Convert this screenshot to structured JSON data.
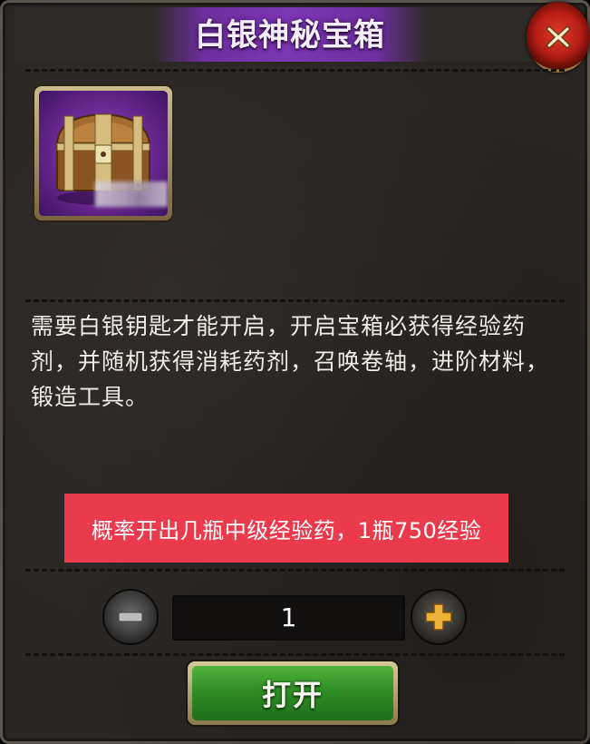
{
  "dialog": {
    "title": "白银神秘宝箱"
  },
  "item": {
    "icon": "treasure-chest-icon",
    "description": "需要白银钥匙才能开启，开启宝箱必获得经验药剂，并随机获得消耗药剂，召唤卷轴，进阶材料，锻造工具。"
  },
  "notice": {
    "text": "概率开出几瓶中级经验药，1瓶750经验"
  },
  "quantity": {
    "value": "1"
  },
  "actions": {
    "open_label": "打开"
  },
  "colors": {
    "title_banner": "#7d36b3",
    "notice_bg": "#ec3a4d",
    "open_button": "#2f8e25",
    "close_button": "#b51d14"
  }
}
